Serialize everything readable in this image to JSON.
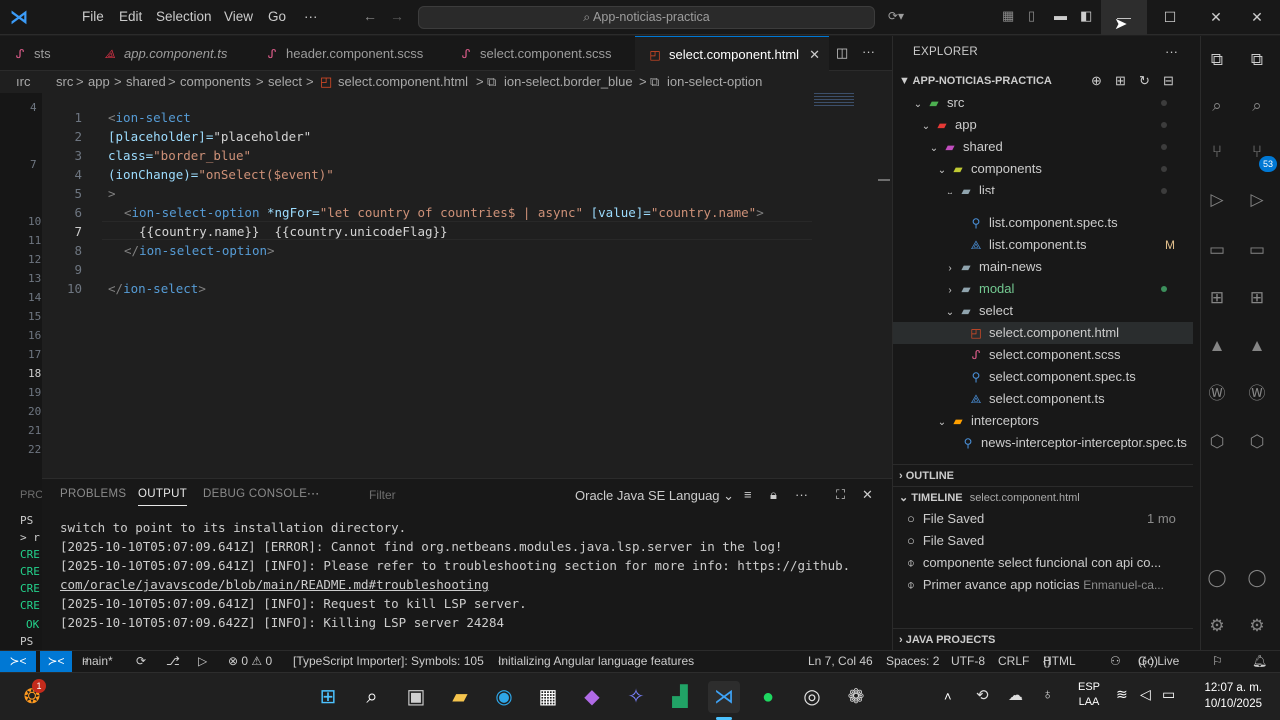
{
  "titlebar": {
    "menus": [
      "File",
      "Edit",
      "Selection",
      "View",
      "Go",
      "···"
    ],
    "search": "App-noticias-practica"
  },
  "tabs": [
    {
      "label": "sts",
      "icon": "scss-icon"
    },
    {
      "label": "app.component.ts",
      "icon": "angular-icon"
    },
    {
      "label": "header.component.scss",
      "icon": "scss-icon"
    },
    {
      "label": "select.component.scss",
      "icon": "scss-icon"
    },
    {
      "label": "select.component.html",
      "icon": "html-icon",
      "active": true
    }
  ],
  "breadcrumb": [
    "src",
    ">",
    "app",
    ">",
    "shared",
    ">",
    "components",
    ">",
    "select",
    ">",
    "select.component.html",
    ">",
    "ion-select.border_blue",
    ">",
    "ion-select-option"
  ],
  "editor": {
    "lines": [
      "1",
      "2",
      "3",
      "4",
      "5",
      "6",
      "7",
      "8",
      "9",
      "10"
    ],
    "current_line": "7",
    "code": [
      [
        "<",
        "ion-select"
      ],
      [
        "[placeholder]=",
        "\"placeholder\""
      ],
      [
        "class=",
        "\"border_blue\""
      ],
      [
        "(ionChange)=",
        "\"onSelect($event)\""
      ],
      [
        ">"
      ],
      [
        "<",
        "ion-select-option",
        " *ngFor=",
        "\"let country of countries$ | async\"",
        " [value]=",
        "\"country.name\"",
        ">"
      ],
      [
        "{{country.name}}  {{country.unicodeFlag}}"
      ],
      [
        "</",
        "ion-select-option",
        ">"
      ],
      [
        ""
      ],
      [
        "</",
        "ion-select",
        ">"
      ]
    ],
    "gutter_left": [
      "4",
      "7",
      "10",
      "11",
      "12",
      "13",
      "14",
      "15",
      "16",
      "17",
      "18",
      "19",
      "20",
      "21",
      "22"
    ]
  },
  "panel": {
    "tabs": [
      "PROBLEMS",
      "OUTPUT",
      "DEBUG CONSOLE",
      "···"
    ],
    "filter_placeholder": "Filter",
    "channel": "Oracle Java SE Languag",
    "output": [
      "switch to point to its installation directory.",
      "[2025-10-10T05:07:09.641Z] [ERROR]: Cannot find org.netbeans.modules.java.lsp.server in the log!",
      "[2025-10-10T05:07:09.641Z] [INFO]: Please refer to troubleshooting section for more info: https://github.",
      "com/oracle/javavscode/blob/main/README.md#troubleshooting",
      "[2025-10-10T05:07:09.641Z] [INFO]: Request to kill LSP server.",
      "[2025-10-10T05:07:09.642Z] [INFO]: Killing LSP server 24284"
    ],
    "left_terminal": [
      "PRO",
      "PS",
      "> r",
      "CRE",
      "CRE",
      "CRE",
      "CRE",
      "OK",
      "PS"
    ]
  },
  "explorer": {
    "header": "EXPLORER",
    "project": "APP-NOTICIAS-PRACTICA",
    "tree": [
      {
        "label": "src",
        "depth": 1,
        "kind": "folder-src",
        "open": true
      },
      {
        "label": "app",
        "depth": 2,
        "kind": "folder-app",
        "open": true
      },
      {
        "label": "shared",
        "depth": 3,
        "kind": "folder-shared",
        "open": true
      },
      {
        "label": "components",
        "depth": 4,
        "kind": "folder-components",
        "open": true
      },
      {
        "label": "list",
        "depth": 5,
        "kind": "folder",
        "open": true
      },
      {
        "label": "list.component.spec.ts",
        "depth": 6,
        "kind": "spec"
      },
      {
        "label": "list.component.ts",
        "depth": 6,
        "kind": "angular",
        "badge": "M"
      },
      {
        "label": "main-news",
        "depth": 5,
        "kind": "folder",
        "open": false
      },
      {
        "label": "modal",
        "depth": 5,
        "kind": "folder",
        "open": false
      },
      {
        "label": "select",
        "depth": 5,
        "kind": "folder",
        "open": true
      },
      {
        "label": "select.component.html",
        "depth": 6,
        "kind": "html",
        "selected": true
      },
      {
        "label": "select.component.scss",
        "depth": 6,
        "kind": "scss"
      },
      {
        "label": "select.component.spec.ts",
        "depth": 6,
        "kind": "spec"
      },
      {
        "label": "select.component.ts",
        "depth": 6,
        "kind": "angular"
      },
      {
        "label": "interceptors",
        "depth": 4,
        "kind": "folder-interceptors",
        "open": true
      },
      {
        "label": "news-interceptor-interceptor.spec.ts",
        "depth": 5,
        "kind": "spec"
      }
    ],
    "outline": "OUTLINE",
    "timeline": "TIMELINE",
    "timeline_file": "select.component.html",
    "timeline_items": [
      {
        "label": "File Saved",
        "meta": "1 mo"
      },
      {
        "label": "File Saved",
        "meta": ""
      },
      {
        "label": "componente select funcional con api co...",
        "meta": ""
      },
      {
        "label": "Primer avance app noticias",
        "meta": "Enmanuel-ca..."
      }
    ],
    "java_projects": "JAVA PROJECTS"
  },
  "rightbar": {
    "badge": "53"
  },
  "status": {
    "branch": "main*",
    "errors": "⊗ 0 ⚠ 0",
    "ts": "[TypeScript Importer]: Symbols: 105",
    "angular": "Initializing Angular language features",
    "position": "Ln 7, Col 46",
    "spaces": "Spaces: 2",
    "encoding": "UTF-8",
    "eol": "CRLF",
    "language": "HTML",
    "golive": "Go Live"
  },
  "taskbar": {
    "lang": "ESP",
    "lang2": "LAA",
    "time": "12:07 a. m.",
    "date": "10/10/2025"
  },
  "colors": {
    "accent": "#0078d4",
    "bg": "#1f1f1f",
    "sidebar": "#181818"
  }
}
